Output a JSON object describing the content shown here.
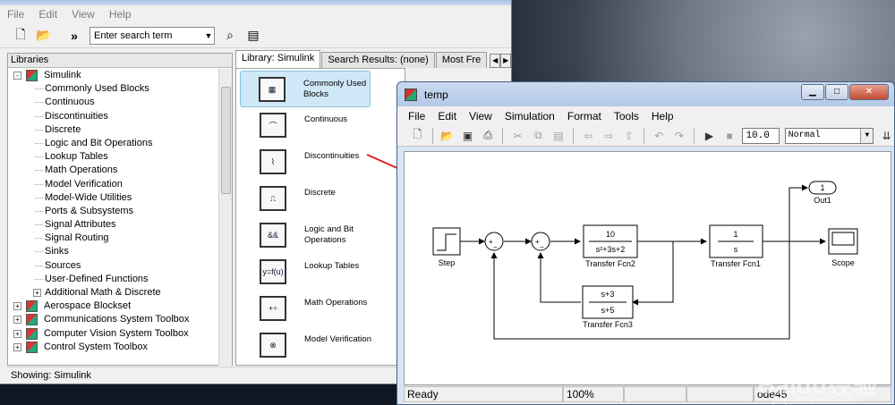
{
  "library": {
    "menu": [
      "File",
      "Edit",
      "View",
      "Help"
    ],
    "more_label": "»",
    "search_placeholder": "Enter search term",
    "pane_header": "Libraries",
    "tree": [
      {
        "label": "Simulink",
        "level": 0,
        "expand": "-",
        "icon": true
      },
      {
        "label": "Commonly Used Blocks",
        "level": 1
      },
      {
        "label": "Continuous",
        "level": 1
      },
      {
        "label": "Discontinuities",
        "level": 1
      },
      {
        "label": "Discrete",
        "level": 1
      },
      {
        "label": "Logic and Bit Operations",
        "level": 1
      },
      {
        "label": "Lookup Tables",
        "level": 1
      },
      {
        "label": "Math Operations",
        "level": 1
      },
      {
        "label": "Model Verification",
        "level": 1
      },
      {
        "label": "Model-Wide Utilities",
        "level": 1
      },
      {
        "label": "Ports & Subsystems",
        "level": 1
      },
      {
        "label": "Signal Attributes",
        "level": 1
      },
      {
        "label": "Signal Routing",
        "level": 1
      },
      {
        "label": "Sinks",
        "level": 1
      },
      {
        "label": "Sources",
        "level": 1
      },
      {
        "label": "User-Defined Functions",
        "level": 1
      },
      {
        "label": "Additional Math & Discrete",
        "level": 1,
        "expand": "+"
      },
      {
        "label": "Aerospace Blockset",
        "level": 0,
        "expand": "+",
        "icon": true
      },
      {
        "label": "Communications System Toolbox",
        "level": 0,
        "expand": "+",
        "icon": true
      },
      {
        "label": "Computer Vision System Toolbox",
        "level": 0,
        "expand": "+",
        "icon": true
      },
      {
        "label": "Control System Toolbox",
        "level": 0,
        "expand": "+",
        "icon": true
      }
    ],
    "tabs": [
      "Library: Simulink",
      "Search Results: (none)",
      "Most Fre"
    ],
    "blocks": [
      {
        "label": "Commonly Used Blocks",
        "icon": "▦"
      },
      {
        "label": "Continuous",
        "icon": "⌒"
      },
      {
        "label": "Discontinuities",
        "icon": "⌇"
      },
      {
        "label": "Discrete",
        "icon": "⎍"
      },
      {
        "label": "Logic and Bit Operations",
        "icon": "&&"
      },
      {
        "label": "Lookup Tables",
        "icon": "y=f(u)"
      },
      {
        "label": "Math Operations",
        "icon": "+÷"
      },
      {
        "label": "Model Verification",
        "icon": "⊗"
      }
    ],
    "status": "Showing: Simulink"
  },
  "model": {
    "title": "temp",
    "menu": [
      "File",
      "Edit",
      "View",
      "Simulation",
      "Format",
      "Tools",
      "Help"
    ],
    "stop_time": "10.0",
    "sim_mode": "Normal",
    "blocks": {
      "step": "Step",
      "tf2_num": "10",
      "tf2_den": "s²+3s+2",
      "tf2_label": "Transfer Fcn2",
      "tf1_num": "1",
      "tf1_den": "s",
      "tf1_label": "Transfer Fcn1",
      "tf3_num": "s+3",
      "tf3_den": "s+5",
      "tf3_label": "Transfer Fcn3",
      "out_num": "1",
      "out_label": "Out1",
      "scope_label": "Scope"
    },
    "status": {
      "ready": "Ready",
      "zoom": "100%",
      "solver": "ode45"
    }
  },
  "watermark": {
    "logo": "Baidu经验",
    "url": "jingyan.baidu.com"
  }
}
